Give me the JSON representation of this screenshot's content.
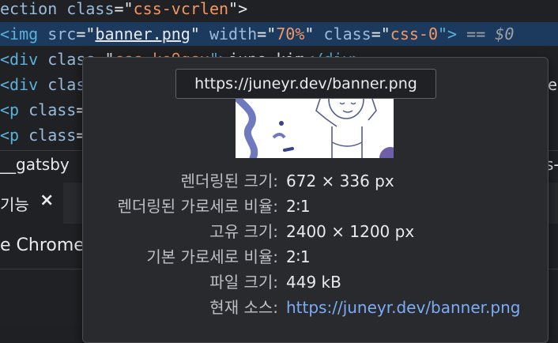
{
  "code": {
    "line1": {
      "prefix": "ection ",
      "attr": "class",
      "eq": "=\"",
      "val": "css-vcrlen",
      "end": "\">"
    },
    "line2": {
      "open": "<img ",
      "src_attr": "src",
      "src_eq": "=\"",
      "src_val": "banner.png",
      "src_end": "\" ",
      "width_attr": "width",
      "width_eq": "=\"",
      "width_val": "70%",
      "width_end": "\" ",
      "class_attr": "class",
      "class_eq": "=\"",
      "class_val": "css-0",
      "close": "\">",
      "selected_marker": " == ",
      "dollar": "$0"
    },
    "line3": {
      "open": "<div ",
      "attr": "class",
      "eq": "=\"",
      "val": "css-ke9gsx",
      "end": "\">",
      "text": "june kim",
      "close": "</div>"
    },
    "line4": {
      "open": "<div ",
      "attr": "clas",
      "trail": "e"
    },
    "line5": {
      "open": "<p ",
      "attr": "class",
      "eq": "="
    },
    "line6": {
      "open": "<p ",
      "attr": "class",
      "eq": "="
    }
  },
  "breadcrumb": {
    "left": "__gatsby",
    "right": "s-"
  },
  "drawer": {
    "tab_label": "기능",
    "close_glyph": "×"
  },
  "message_bar": {
    "text": "e Chrome"
  },
  "tooltip": {
    "url": "https://juneyr.dev/banner.png"
  },
  "image_info": {
    "rows": [
      {
        "label": "렌더링된 크기:",
        "value": "672 × 336 px"
      },
      {
        "label": "렌더링된 가로세로 비율:",
        "value": "2∶1"
      },
      {
        "label": "고유 크기:",
        "value": "2400 × 1200 px"
      },
      {
        "label": "기본 가로세로 비율:",
        "value": "2∶1"
      },
      {
        "label": "파일 크기:",
        "value": "449 kB"
      },
      {
        "label": "현재 소스:",
        "value": "https://juneyr.dev/banner.png"
      }
    ]
  },
  "colors": {
    "selected_row": "#1c3a5e",
    "tag": "#5db0d7",
    "attr_value": "#f29766",
    "link": "#7cacf8"
  }
}
